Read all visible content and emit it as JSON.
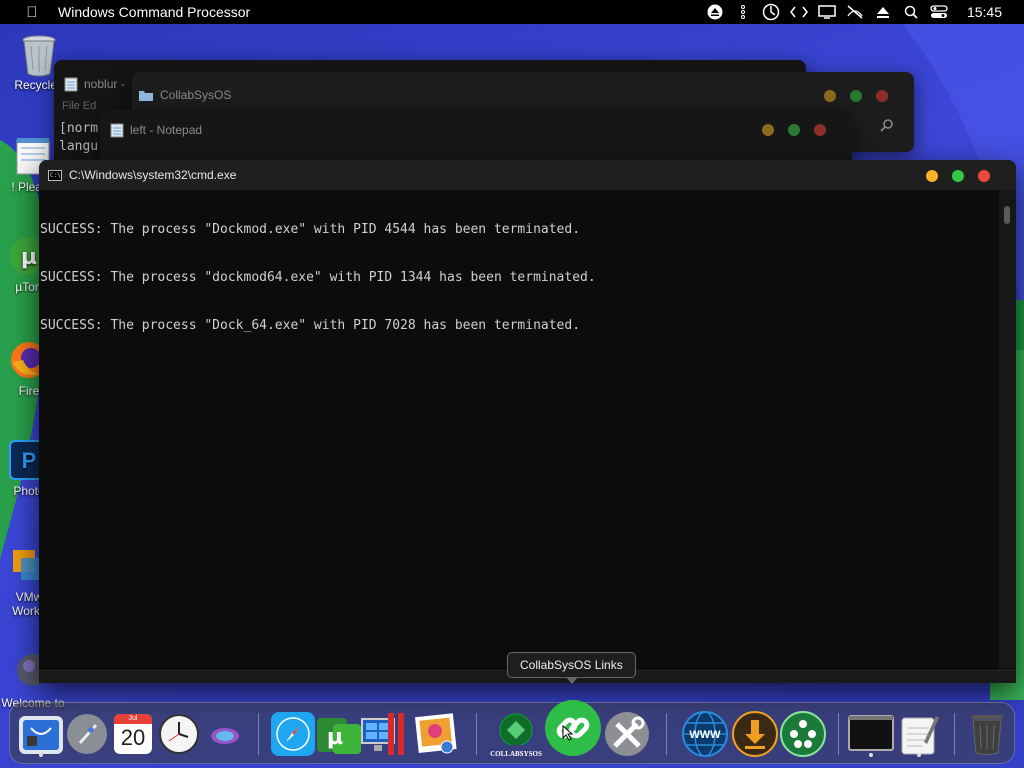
{
  "menubar": {
    "app_title": "Windows Command Processor",
    "clock": "15:45",
    "icons": [
      "eject-icon",
      "network-icon",
      "power-icon",
      "code-icon",
      "display-icon",
      "mute-icon",
      "upload-icon",
      "search-icon",
      "control-center-icon"
    ]
  },
  "desktop": {
    "icons": [
      {
        "label": "Recycle I",
        "name": "recycle-bin-icon"
      },
      {
        "label": "! Please",
        "name": "notepad-file-icon"
      },
      {
        "label": "µTorr",
        "name": "utorrent-icon"
      },
      {
        "label": "Fire",
        "name": "firefox-icon"
      },
      {
        "label": "Photo",
        "name": "photoshop-icon"
      },
      {
        "label": "VMw",
        "label2": "Works",
        "name": "vmware-icon"
      },
      {
        "label": "Welcome to",
        "name": "welcome-icon"
      }
    ]
  },
  "background_windows": {
    "notepad1_title": "noblur -",
    "notepad1_menu": "File   Ed",
    "notepad1_line1": "[norm",
    "notepad1_line2": "langu",
    "explorer_title": "CollabSysOS",
    "notepad2_title": "left - Notepad"
  },
  "cmd": {
    "title": "C:\\Windows\\system32\\cmd.exe",
    "lines": [
      "SUCCESS: The process \"Dockmod.exe\" with PID 4544 has been terminated.",
      "SUCCESS: The process \"dockmod64.exe\" with PID 1344 has been terminated.",
      "SUCCESS: The process \"Dock_64.exe\" with PID 7028 has been terminated."
    ]
  },
  "tooltip": "CollabSysOS Links",
  "dock": {
    "calendar_month": "Jul",
    "calendar_day": "20",
    "collabsysos_label": "COLLABSYSOS"
  },
  "colors": {
    "desktop": "#3340c8",
    "close": "#ed4a3f",
    "minimize": "#f5b428",
    "maximize": "#33c748"
  }
}
